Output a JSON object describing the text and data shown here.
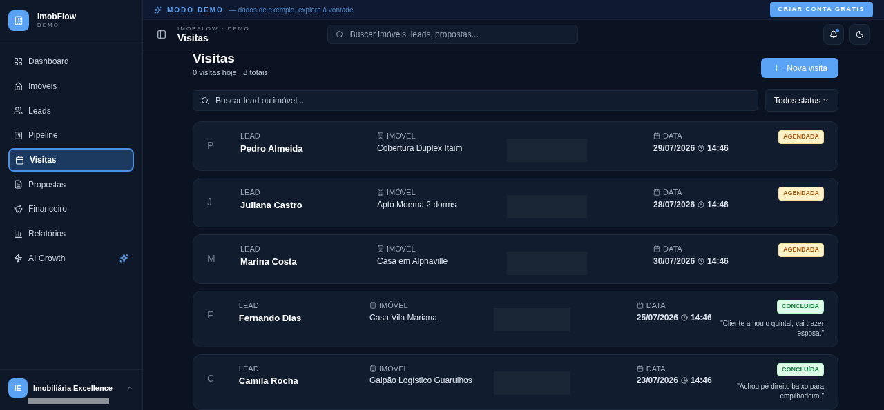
{
  "brand": {
    "name": "ImobFlow",
    "tag": "DEMO"
  },
  "sidebar": {
    "items": [
      {
        "label": "Dashboard",
        "selected": false
      },
      {
        "label": "Imóveis",
        "selected": false
      },
      {
        "label": "Leads",
        "selected": false
      },
      {
        "label": "Pipeline",
        "selected": false
      },
      {
        "label": "Visitas",
        "selected": true
      },
      {
        "label": "Propostas",
        "selected": false
      },
      {
        "label": "Financeiro",
        "selected": false
      },
      {
        "label": "Relatórios",
        "selected": false
      },
      {
        "label": "AI Growth",
        "selected": false,
        "sparkle": true
      }
    ],
    "account": {
      "initials": "IE",
      "name": "Imobiliária Excellence"
    }
  },
  "banner": {
    "label": "MODO DEMO",
    "text": "— dados de exemplo, explore à vontade",
    "button": "CRIAR CONTA GRÁTIS"
  },
  "header": {
    "breadcrumb": "IMOBFLOW · DEMO",
    "title": "Visitas",
    "search_placeholder": "Buscar imóveis, leads, propostas...",
    "notification_dot": true
  },
  "page": {
    "title": "Visitas",
    "subtitle": "0 visitas hoje · 8 totais",
    "new_button": "Nova visita",
    "search_placeholder": "Buscar lead ou imóvel...",
    "filter": "Todos status"
  },
  "visits": [
    {
      "initial": "P",
      "lead_label": "LEAD",
      "lead": "Pedro Almeida",
      "property_label": "IMÓVEL",
      "property": "Cobertura Duplex Itaim",
      "date_label": "DATA",
      "date": "29/07/2026",
      "time": "14:46",
      "status": {
        "kind": "agendada",
        "label": "AGENDADA"
      }
    },
    {
      "initial": "J",
      "lead_label": "LEAD",
      "lead": "Juliana Castro",
      "property_label": "IMÓVEL",
      "property": "Apto Moema 2 dorms",
      "date_label": "DATA",
      "date": "28/07/2026",
      "time": "14:46",
      "status": {
        "kind": "agendada",
        "label": "AGENDADA"
      }
    },
    {
      "initial": "M",
      "lead_label": "LEAD",
      "lead": "Marina Costa",
      "property_label": "IMÓVEL",
      "property": "Casa em Alphaville",
      "date_label": "DATA",
      "date": "30/07/2026",
      "time": "14:46",
      "status": {
        "kind": "agendada",
        "label": "AGENDADA"
      }
    },
    {
      "initial": "F",
      "lead_label": "LEAD",
      "lead": "Fernando Dias",
      "property_label": "IMÓVEL",
      "property": "Casa Vila Mariana",
      "date_label": "DATA",
      "date": "25/07/2026",
      "time": "14:46",
      "status": {
        "kind": "concluida",
        "label": "CONCLUÍDA"
      },
      "note": "\"Cliente amou o quintal, vai trazer esposa.\""
    },
    {
      "initial": "C",
      "lead_label": "LEAD",
      "lead": "Camila Rocha",
      "property_label": "IMÓVEL",
      "property": "Galpão Logístico Guarulhos",
      "date_label": "DATA",
      "date": "23/07/2026",
      "time": "14:46",
      "status": {
        "kind": "concluida",
        "label": "CONCLUÍDA"
      },
      "note": "\"Achou pé-direito baixo para empilhadeira.\""
    }
  ]
}
